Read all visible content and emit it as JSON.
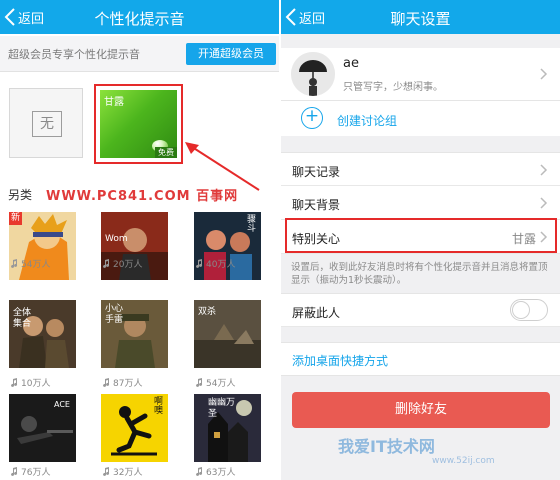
{
  "left": {
    "back_label": "返回",
    "title": "个性化提示音",
    "vip_text": "超级会员专享个性化提示音",
    "vip_button": "开通超级会员",
    "none_label": "无",
    "selected_tone": {
      "name": "甘露",
      "badge": "免费"
    },
    "section_title": "另类",
    "watermark": "WWW.PC841.COM 百事网",
    "tiles": [
      {
        "tag": "新",
        "label": "",
        "count": "54万人"
      },
      {
        "tag": "",
        "label": "Wom",
        "count": "20万人"
      },
      {
        "tag": "",
        "label": "骤斗",
        "count": "40万人"
      },
      {
        "tag": "",
        "label": "全体集合",
        "count": "10万人"
      },
      {
        "tag": "",
        "label": "小心手雷",
        "count": "87万人"
      },
      {
        "tag": "",
        "label": "双杀",
        "count": "54万人"
      },
      {
        "tag": "",
        "label": "ACE",
        "count": "76万人"
      },
      {
        "tag": "",
        "label": "啊噢",
        "count": "32万人"
      },
      {
        "tag": "",
        "label": "幽幽万圣",
        "count": "63万人"
      }
    ]
  },
  "right": {
    "back_label": "返回",
    "title": "聊天设置",
    "profile": {
      "name": "ae",
      "signature": "只管写字，少想闲事。"
    },
    "create_group": "创建讨论组",
    "rows": {
      "chat_history": "聊天记录",
      "chat_background": "聊天背景",
      "special_care": "特别关心",
      "special_care_value": "甘露",
      "block": "屏蔽此人"
    },
    "help_text": "设置后，收到此好友消息时将有个性化提示音并且消息将置顶显示（振动为1秒长震动）。",
    "add_shortcut": "添加桌面快捷方式",
    "delete_friend": "删除好友",
    "block_enabled": false
  },
  "footer_brand": {
    "name": "我爱IT技术网",
    "url": "www.52ij.com"
  },
  "colors": {
    "accent": "#12a8ea",
    "highlight": "#e52a2a",
    "delete": "#e95a52",
    "green_tile": "#4cb51d"
  }
}
